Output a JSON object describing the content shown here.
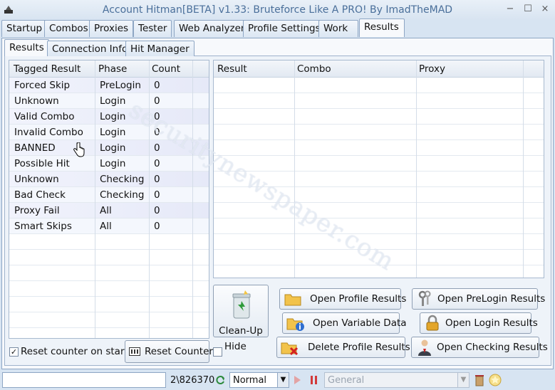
{
  "window": {
    "title": "Account Hitman[BETA] v1.33: Bruteforce Like A PRO!  By ImadTheMAD",
    "minimize": "−",
    "maximize": "☐",
    "close": "×"
  },
  "main_tabs": [
    "Startup",
    "Combos",
    "Proxies",
    "Tester",
    "Web Analyzer",
    "Profile Settings",
    "Work",
    "Results"
  ],
  "active_main_tab": "Results",
  "sub_tabs": [
    "Results",
    "Connection Info",
    "Hit Manager"
  ],
  "active_sub_tab": "Results",
  "left_table": {
    "headers": [
      "Tagged Result",
      "Phase",
      "Count"
    ],
    "rows": [
      [
        "Forced Skip",
        "PreLogin",
        "0"
      ],
      [
        "Unknown",
        "Login",
        "0"
      ],
      [
        "Valid Combo",
        "Login",
        "0"
      ],
      [
        "Invalid Combo",
        "Login",
        "0"
      ],
      [
        "BANNED",
        "Login",
        "0"
      ],
      [
        "Possible Hit",
        "Login",
        "0"
      ],
      [
        "Unknown",
        "Checking",
        "0"
      ],
      [
        "Bad Check",
        "Checking",
        "0"
      ],
      [
        "Proxy Fail",
        "All",
        "0"
      ],
      [
        "Smart Skips",
        "All",
        "0"
      ]
    ]
  },
  "right_table": {
    "headers": [
      "Result",
      "Combo",
      "Proxy"
    ]
  },
  "controls": {
    "cleanup": "Clean-Up",
    "reset_on_start": "Reset counter on start",
    "reset_counter": "Reset Counter",
    "hide": "Hide",
    "open_profile_results": "Open Profile Results",
    "open_variable_data": "Open Variable Data",
    "delete_profile_results": "Delete Profile Results",
    "open_prelogin_results": "Open PreLogin Results",
    "open_login_results": "Open Login Results",
    "open_checking_results": "Open Checking Results"
  },
  "statusbar": {
    "input_value": "",
    "progress_text": "2\\826370",
    "mode": "Normal",
    "profile": "General"
  },
  "watermark": "securitynewspaper.com",
  "colors": {
    "title": "#4a6f9a",
    "row_tint": "#e6e9f8"
  }
}
